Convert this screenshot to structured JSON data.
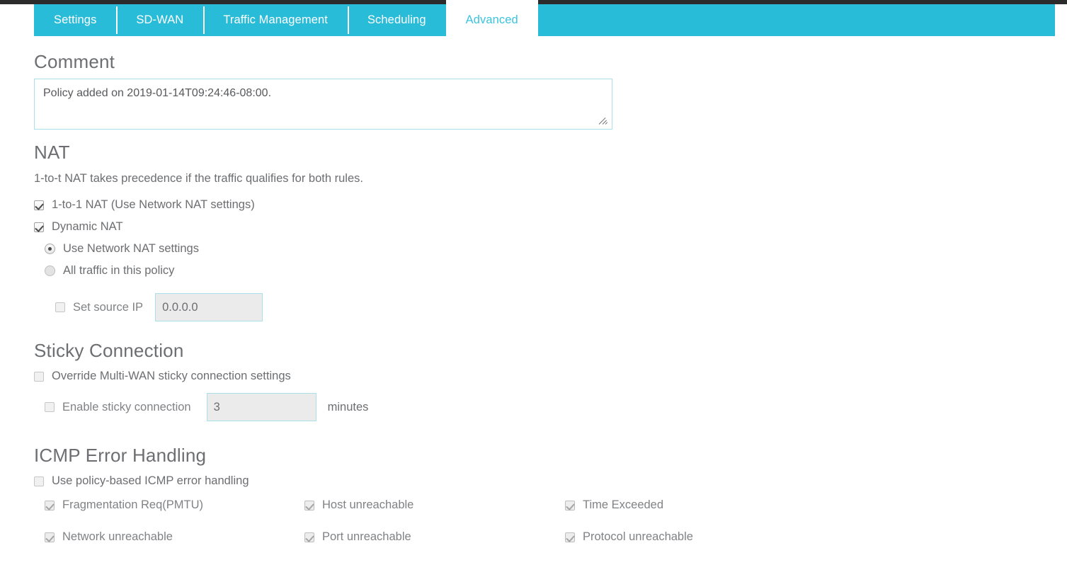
{
  "tabs": [
    {
      "label": "Settings",
      "active": false
    },
    {
      "label": "SD-WAN",
      "active": false
    },
    {
      "label": "Traffic Management",
      "active": false
    },
    {
      "label": "Scheduling",
      "active": false
    },
    {
      "label": "Advanced",
      "active": true
    }
  ],
  "colors": {
    "tab_bar": "#29bcd9",
    "active_tab_text": "#3cc3de",
    "input_border": "#a9e0ea",
    "text": "#6d6e71",
    "disabled_field_bg": "#ebebeb",
    "top_strip": "#2b2b2b"
  },
  "comment": {
    "heading": "Comment",
    "value": "Policy added on 2019-01-14T09:24:46-08:00.",
    "placeholder": ""
  },
  "nat": {
    "heading": "NAT",
    "hint": "1-to-t NAT takes precedence if the traffic qualifies for both rules.",
    "one_to_one": {
      "label": "1-to-1 NAT (Use Network NAT settings)",
      "checked": true
    },
    "dynamic": {
      "label": "Dynamic NAT",
      "checked": true
    },
    "radios": [
      {
        "label": "Use Network NAT settings",
        "selected": true
      },
      {
        "label": "All traffic in this policy",
        "selected": false
      }
    ],
    "set_source_ip": {
      "label": "Set source IP",
      "checked": false
    },
    "source_ip_value": "0.0.0.0"
  },
  "sticky": {
    "heading": "Sticky Connection",
    "override": {
      "label": "Override Multi-WAN sticky connection settings",
      "checked": false
    },
    "enable": {
      "label": "Enable sticky connection",
      "checked": false
    },
    "minutes_value": "3",
    "minutes_unit": "minutes"
  },
  "icmp": {
    "heading": "ICMP Error Handling",
    "use_policy_based": {
      "label": "Use policy-based ICMP error handling",
      "checked": false
    },
    "options": [
      {
        "label": "Fragmentation Req(PMTU)",
        "checked": true
      },
      {
        "label": "Host unreachable",
        "checked": true
      },
      {
        "label": "Time Exceeded",
        "checked": true
      },
      {
        "label": "Network unreachable",
        "checked": true
      },
      {
        "label": "Port unreachable",
        "checked": true
      },
      {
        "label": "Protocol unreachable",
        "checked": true
      }
    ]
  }
}
